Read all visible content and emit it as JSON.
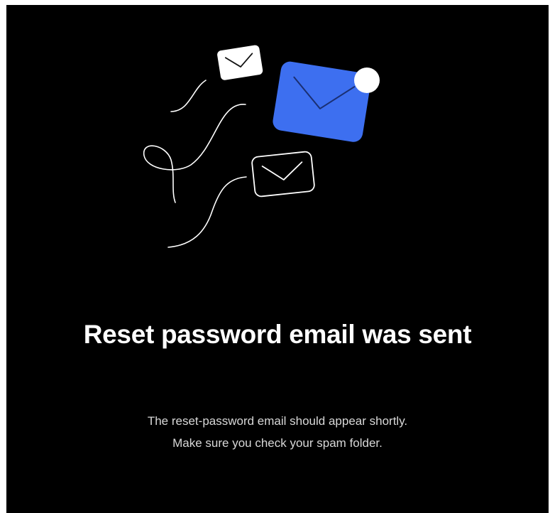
{
  "dialog": {
    "title": "Reset password email was sent",
    "message_line_1": "The reset-password email should appear shortly.",
    "message_line_2": "Make sure you check your spam folder."
  },
  "illustration": {
    "icons": [
      "envelope-icon",
      "envelope-icon",
      "envelope-icon",
      "notification-dot-icon"
    ],
    "accent_color": "#3d6ff0",
    "background_color": "#000000",
    "foreground_color": "#ffffff"
  }
}
